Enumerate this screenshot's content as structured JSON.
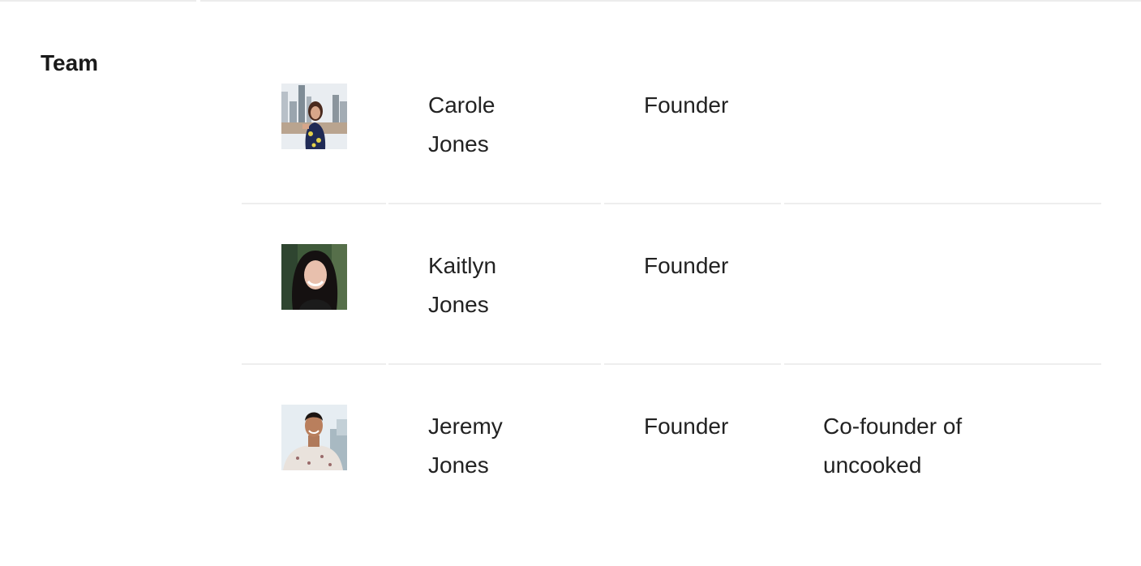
{
  "section": {
    "title": "Team"
  },
  "team": [
    {
      "first_name": "Carole",
      "last_name": "Jones",
      "role": "Founder",
      "bio": "",
      "avatar_icon": "person-photo-icon"
    },
    {
      "first_name": "Kaitlyn",
      "last_name": "Jones",
      "role": "Founder",
      "bio": "",
      "avatar_icon": "person-photo-icon"
    },
    {
      "first_name": "Jeremy",
      "last_name": "Jones",
      "role": "Founder",
      "bio": "Co-founder of uncooked",
      "avatar_icon": "person-photo-icon"
    }
  ],
  "colors": {
    "text": "#222222",
    "divider": "#eeeeee"
  }
}
